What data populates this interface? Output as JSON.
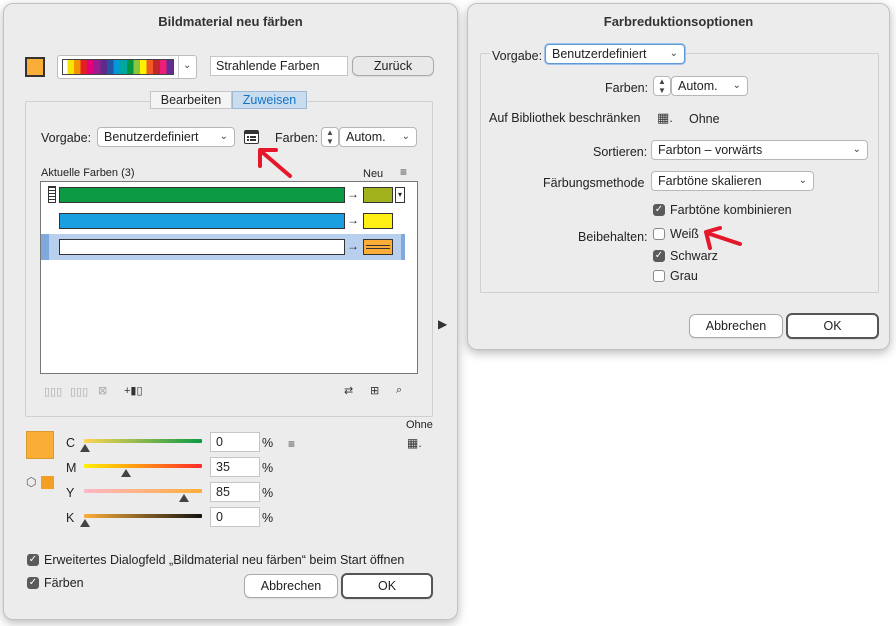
{
  "left_dialog": {
    "title": "Bildmaterial neu färben",
    "group_name": "Strahlende Farben",
    "back_button": "Zurück",
    "tabs": [
      "Bearbeiten",
      "Zuweisen"
    ],
    "active_tab": "Zuweisen",
    "preset_label": "Vorgabe:",
    "preset_value": "Benutzerdefiniert",
    "colors_label": "Farben:",
    "colors_value": "Autom.",
    "current_colors_label": "Aktuelle Farben (3)",
    "new_label": "Neu",
    "rows": [
      {
        "current": "#0c9a45",
        "new": "#a2b21c"
      },
      {
        "current": "#1aa0e0",
        "new": "#ffef14"
      },
      {
        "current": "#ffffff",
        "new": "#fbae37"
      }
    ],
    "ohne_label": "Ohne",
    "cmyk": [
      {
        "label": "C",
        "value": "0",
        "unit": "%",
        "pos": 0.0
      },
      {
        "label": "M",
        "value": "35",
        "unit": "%",
        "pos": 0.35
      },
      {
        "label": "Y",
        "value": "85",
        "unit": "%",
        "pos": 0.85
      },
      {
        "label": "K",
        "value": "0",
        "unit": "%",
        "pos": 0.0
      }
    ],
    "current_fill": "#fbae37",
    "checkbox_advanced": "Erweitertes Dialogfeld „Bildmaterial neu färben“ beim Start öffnen",
    "checkbox_colors": "Färben",
    "cancel": "Abbrechen",
    "ok": "OK"
  },
  "right_dialog": {
    "title": "Farbreduktionsoptionen",
    "preset_label": "Vorgabe:",
    "preset_value": "Benutzerdefiniert",
    "colors_label": "Farben:",
    "colors_value": "Autom.",
    "library_label": "Auf Bibliothek beschränken",
    "library_value": "Ohne",
    "sort_label": "Sortieren:",
    "sort_value": "Farbton – vorwärts",
    "method_label": "Färbungsmethode",
    "method_value": "Farbtöne skalieren",
    "combine_label": "Farbtöne kombinieren",
    "keep_label": "Beibehalten:",
    "keep_white": "Weiß",
    "keep_black": "Schwarz",
    "keep_gray": "Grau",
    "cancel": "Abbrechen",
    "ok": "OK"
  }
}
